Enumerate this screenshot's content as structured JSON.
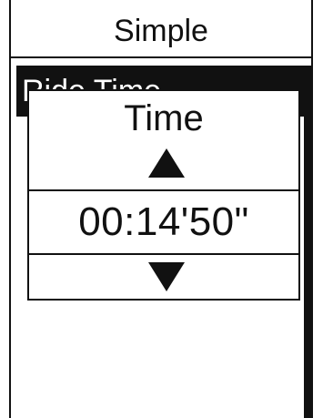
{
  "screen": {
    "title": "Simple"
  },
  "list": {
    "selected_item_label": "Ride Time"
  },
  "popup": {
    "label": "Time",
    "value": "00:14'50\"",
    "up_icon": "triangle-up-icon",
    "down_icon": "triangle-down-icon"
  },
  "colors": {
    "foreground": "#111111",
    "background": "#ffffff"
  }
}
